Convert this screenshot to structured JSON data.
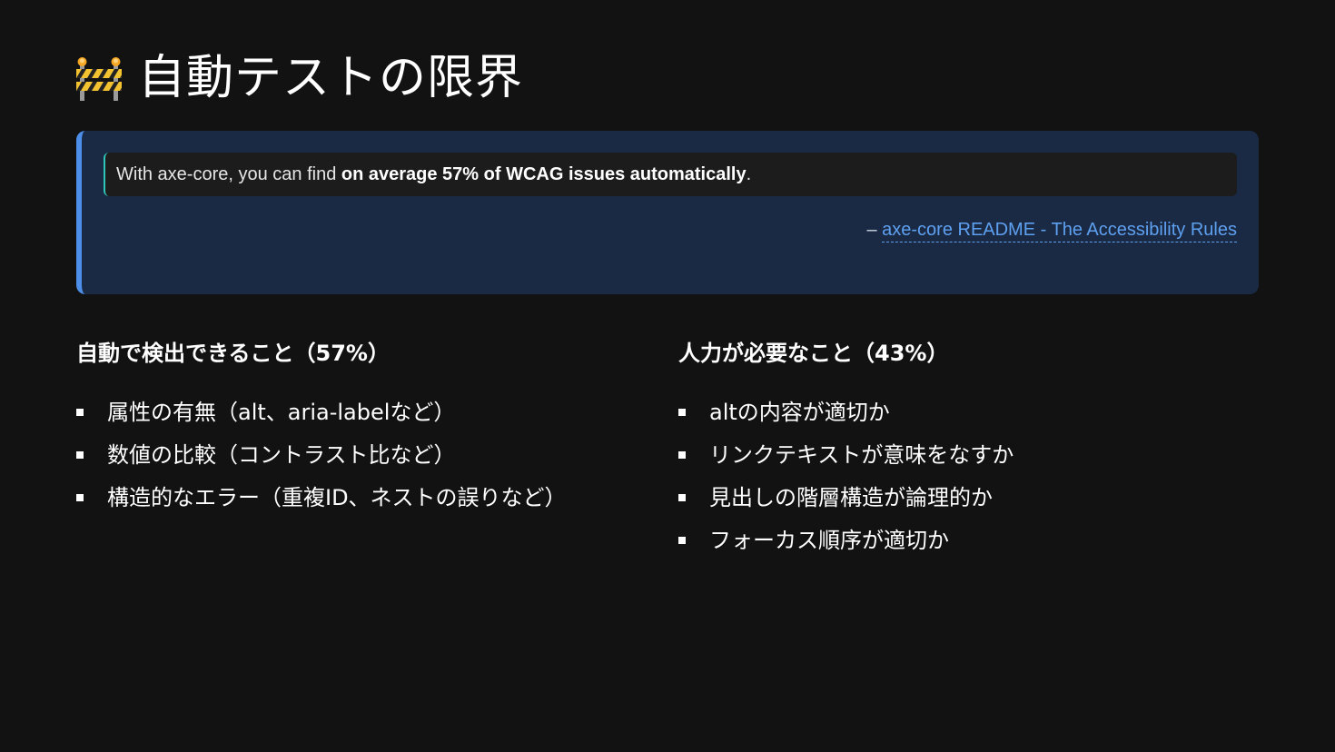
{
  "title": {
    "icon": "construction-barrier-icon",
    "text": "自動テストの限界"
  },
  "quote": {
    "prefix": "With axe-core, you can find ",
    "emphasis": "on average 57% of WCAG issues automatically",
    "suffix": ".",
    "attribution_dash": "– ",
    "attribution_link": "axe-core README - The Accessibility Rules"
  },
  "left_column": {
    "heading": "自動で検出できること（57%）",
    "items": [
      "属性の有無（alt、aria-labelなど）",
      "数値の比較（コントラスト比など）",
      "構造的なエラー（重複ID、ネストの誤りなど）"
    ]
  },
  "right_column": {
    "heading": "人力が必要なこと（43%）",
    "items": [
      "altの内容が適切か",
      "リンクテキストが意味をなすか",
      "見出しの階層構造が論理的か",
      "フォーカス順序が適切か"
    ]
  },
  "colors": {
    "background": "#121212",
    "quote_bg": "#1b2a44",
    "quote_border": "#4d8fe8",
    "inner_quote_border": "#2ec4b6",
    "link": "#5ea0f0"
  }
}
